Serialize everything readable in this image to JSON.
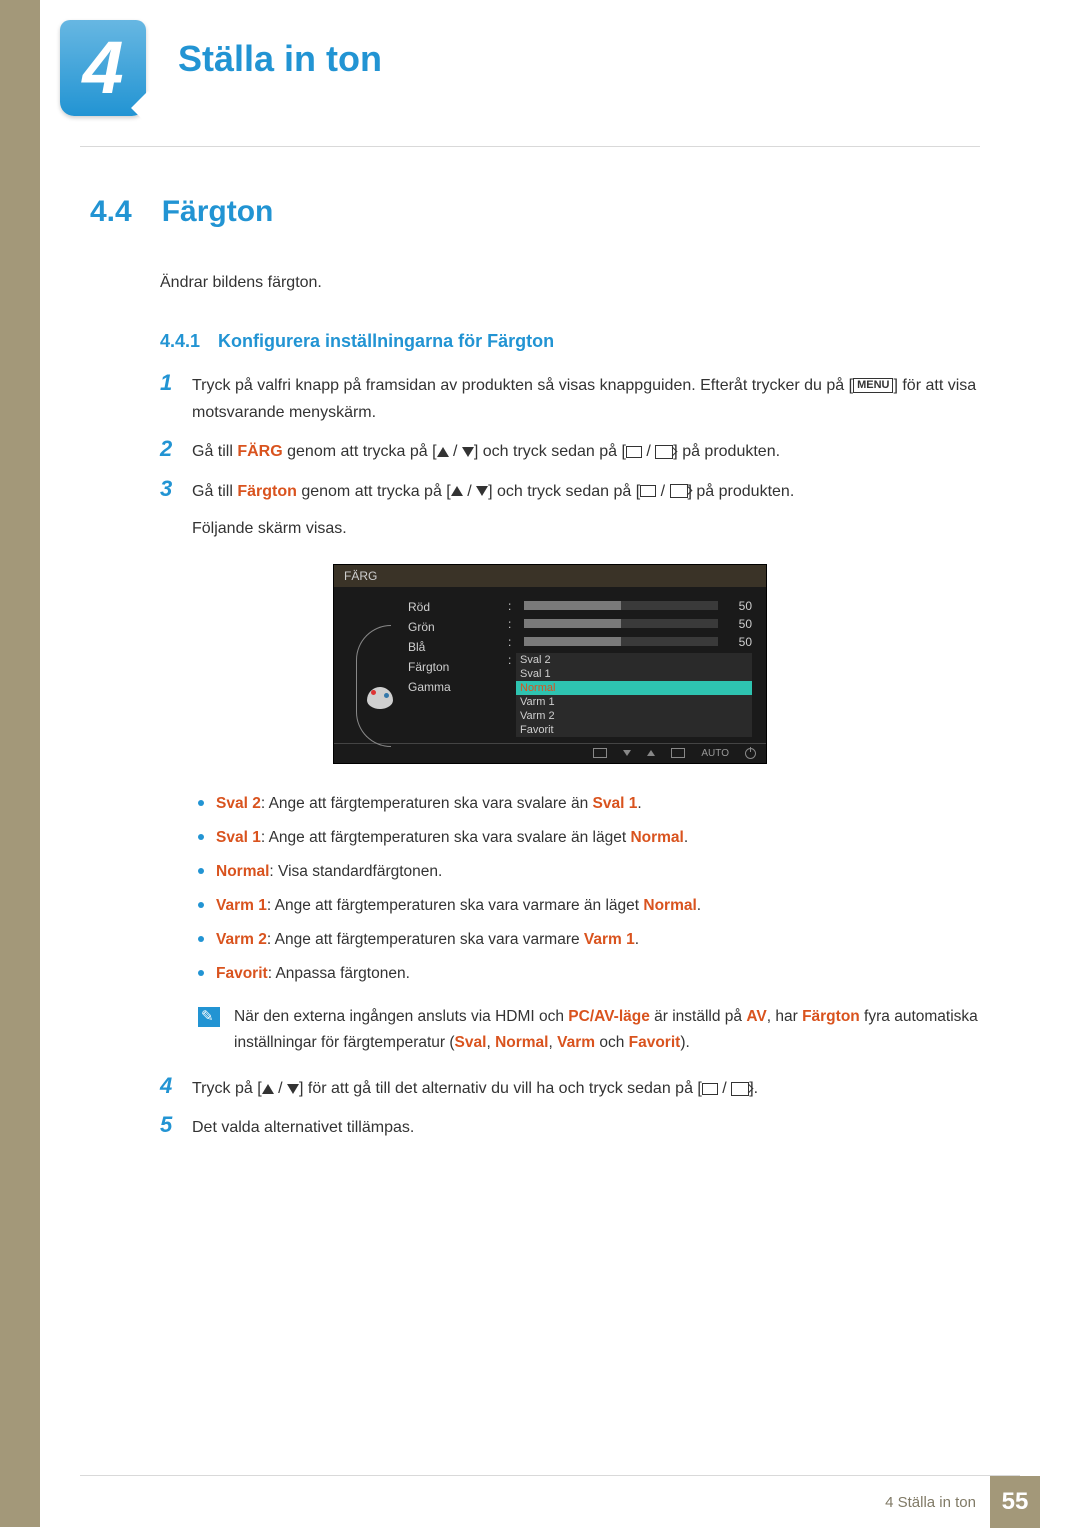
{
  "chapter": {
    "number": "4",
    "title": "Ställa in ton"
  },
  "section": {
    "number": "4.4",
    "title": "Färgton",
    "intro": "Ändrar bildens färgton."
  },
  "subsection": {
    "number": "4.4.1",
    "title": "Konfigurera inställningarna för Färgton"
  },
  "steps": {
    "s1": {
      "num": "1",
      "t1": "Tryck på valfri knapp på framsidan av produkten så visas knappguiden. Efteråt trycker du på [",
      "menu": "MENU",
      "t2": "] för att visa motsvarande menyskärm."
    },
    "s2": {
      "num": "2",
      "pre": "Gå till ",
      "farg": "FÄRG",
      "mid": " genom att trycka på [",
      "mid2": "] och tryck sedan på [",
      "post": "] på produkten."
    },
    "s3": {
      "num": "3",
      "pre": "Gå till ",
      "fargton": "Färgton",
      "mid": " genom att trycka på [",
      "mid2": "] och tryck sedan på [",
      "post": "] på produkten.",
      "follow": "Följande skärm visas."
    },
    "s4": {
      "num": "4",
      "t1": "Tryck på [",
      "t2": "] för att gå till det alternativ du vill ha och tryck sedan på [",
      "t3": "]."
    },
    "s5": {
      "num": "5",
      "text": "Det valda alternativet tillämpas."
    }
  },
  "osd": {
    "title": "FÄRG",
    "items": {
      "red": "Röd",
      "green": "Grön",
      "blue": "Blå",
      "tone": "Färgton",
      "gamma": "Gamma"
    },
    "values": {
      "red": "50",
      "green": "50",
      "blue": "50",
      "red_pct": 50,
      "green_pct": 50,
      "blue_pct": 50
    },
    "options": {
      "sval2": "Sval 2",
      "sval1": "Sval 1",
      "normal": "Normal",
      "varm1": "Varm 1",
      "varm2": "Varm 2",
      "favorit": "Favorit"
    },
    "footer": {
      "auto": "AUTO"
    }
  },
  "bullets": {
    "b1": {
      "k": "Sval 2",
      "t1": ": Ange att färgtemperaturen ska vara svalare än ",
      "k2": "Sval 1",
      "t2": "."
    },
    "b2": {
      "k": "Sval 1",
      "t1": ": Ange att färgtemperaturen ska vara svalare än läget ",
      "k2": "Normal",
      "t2": "."
    },
    "b3": {
      "k": "Normal",
      "t1": ": Visa standardfärgtonen."
    },
    "b4": {
      "k": "Varm 1",
      "t1": ": Ange att färgtemperaturen ska vara varmare än läget ",
      "k2": "Normal",
      "t2": "."
    },
    "b5": {
      "k": "Varm 2",
      "t1": ": Ange att färgtemperaturen ska vara varmare ",
      "k2": "Varm 1",
      "t2": "."
    },
    "b6": {
      "k": "Favorit",
      "t1": ": Anpassa färgtonen."
    }
  },
  "note": {
    "t1": "När den externa ingången ansluts via HDMI och ",
    "pcav": "PC/AV-läge",
    "t2": " är inställd på ",
    "av": "AV",
    "t3": ", har ",
    "fargton": "Färgton",
    "t4": " fyra automatiska inställningar för färgtemperatur (",
    "sval": "Sval",
    "c1": ", ",
    "normal": "Normal",
    "c2": ", ",
    "varm": "Varm",
    "c3": " och ",
    "favorit": "Favorit",
    "t5": ")."
  },
  "footer": {
    "chapter_ref": "4 Ställa in ton",
    "page_number": "55"
  }
}
